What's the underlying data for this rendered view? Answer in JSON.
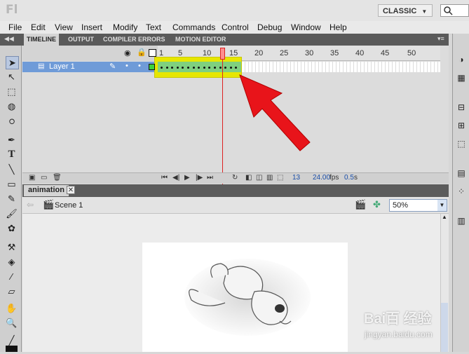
{
  "window": {
    "app_logo": "Fl",
    "workspace": "CLASSIC",
    "workspace_caret": "▼",
    "search_icon": "search-icon"
  },
  "menu": [
    "File",
    "Edit",
    "View",
    "Insert",
    "Modify",
    "Text",
    "Commands",
    "Control",
    "Debug",
    "Window",
    "Help"
  ],
  "panel_tabs": [
    "TIMELINE",
    "OUTPUT",
    "COMPILER ERRORS",
    "MOTION EDITOR"
  ],
  "timeline": {
    "ruler": [
      "1",
      "5",
      "10",
      "15",
      "20",
      "25",
      "30",
      "35",
      "40",
      "45",
      "50"
    ],
    "layer_name": "Layer 1",
    "current_frame": "13",
    "fps": "24.00",
    "fps_unit": "fps",
    "elapsed": "0.5",
    "elapsed_unit": "s",
    "keyframe_count": 15
  },
  "document": {
    "tab": "animation",
    "close": "✕",
    "scene": "Scene 1",
    "zoom": "50%"
  },
  "watermark": {
    "brand": "Bai百 经验",
    "url": "jingyan.baidu.com"
  },
  "colors": {
    "highlight": "#e6e600",
    "arrow": "#e8141a",
    "playhead": "#d22222",
    "layer_selected": "#6f9bd8"
  }
}
